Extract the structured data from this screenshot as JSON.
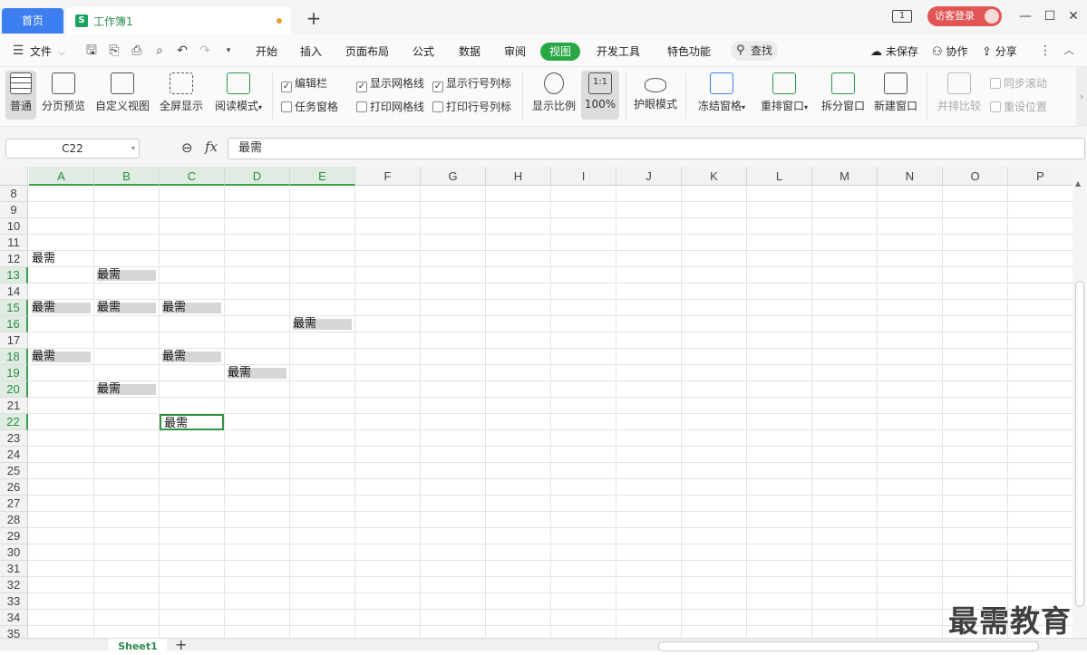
{
  "tabbar": {
    "home_label": "首页",
    "doc_title": "工作簿1",
    "doc_icon": "S",
    "new_tab_symbol": "+",
    "login_label": "访客登录",
    "window_count_icon": "1"
  },
  "menubar": {
    "file_label": "文件",
    "items": [
      "开始",
      "插入",
      "页面布局",
      "公式",
      "数据",
      "审阅",
      "视图",
      "开发工具",
      "特色功能"
    ],
    "active_item": "视图",
    "search_label": "查找",
    "unsaved_label": "未保存",
    "collab_label": "协作",
    "share_label": "分享"
  },
  "ribbon": {
    "normal_label": "普通",
    "page_break_label": "分页预览",
    "custom_view_label": "自定义视图",
    "fullscreen_label": "全屏显示",
    "read_mode_label": "阅读模式",
    "edit_bar_label": "编辑栏",
    "task_pane_label": "任务窗格",
    "show_gridlines_label": "显示网格线",
    "print_gridlines_label": "打印网格线",
    "show_headers_label": "显示行号列标",
    "print_headers_label": "打印行号列标",
    "zoom_label": "显示比例",
    "zoom_100_label": "100%",
    "zoom_100_icon": "1:1",
    "eye_mode_label": "护眼模式",
    "freeze_label": "冻结窗格",
    "rearrange_label": "重排窗口",
    "split_label": "拆分窗口",
    "new_window_label": "新建窗口",
    "side_by_side_label": "并排比较",
    "sync_scroll_label": "同步滚动",
    "reset_position_label": "重设位置",
    "checkbox_states": {
      "edit_bar": true,
      "task_pane": false,
      "show_gridlines": true,
      "print_gridlines": false,
      "show_headers": true,
      "print_headers": false
    }
  },
  "formula_bar": {
    "name_box": "C22",
    "fx_label": "fx",
    "value": "最需"
  },
  "grid": {
    "columns": [
      "A",
      "B",
      "C",
      "D",
      "E",
      "F",
      "G",
      "H",
      "I",
      "J",
      "K",
      "L",
      "M",
      "N",
      "O",
      "P"
    ],
    "selected_columns": [
      "A",
      "B",
      "C",
      "D",
      "E"
    ],
    "rows": [
      8,
      9,
      10,
      11,
      12,
      13,
      14,
      15,
      16,
      17,
      18,
      19,
      20,
      21,
      22,
      23,
      24,
      25,
      26,
      27,
      28,
      29,
      30,
      31,
      32,
      33,
      34,
      35
    ],
    "selected_rows": [
      13,
      15,
      16,
      18,
      19,
      20,
      22
    ],
    "cells": [
      {
        "row": 12,
        "col": "A",
        "text": "最需",
        "highlight": false
      },
      {
        "row": 13,
        "col": "B",
        "text": "最需",
        "highlight": true
      },
      {
        "row": 15,
        "col": "A",
        "text": "最需",
        "highlight": true
      },
      {
        "row": 15,
        "col": "B",
        "text": "最需",
        "highlight": true
      },
      {
        "row": 15,
        "col": "C",
        "text": "最需",
        "highlight": true
      },
      {
        "row": 16,
        "col": "E",
        "text": "最需",
        "highlight": true
      },
      {
        "row": 18,
        "col": "A",
        "text": "最需",
        "highlight": true
      },
      {
        "row": 18,
        "col": "C",
        "text": "最需",
        "highlight": true
      },
      {
        "row": 19,
        "col": "D",
        "text": "最需",
        "highlight": true
      },
      {
        "row": 20,
        "col": "B",
        "text": "最需",
        "highlight": true
      },
      {
        "row": 22,
        "col": "C",
        "text": "最需",
        "highlight": false,
        "active": true
      }
    ]
  },
  "sheets": {
    "tabs": [
      "Sheet1"
    ],
    "add_symbol": "+"
  },
  "watermark": "最需教育",
  "colors": {
    "accent_green": "#28a745",
    "home_tab_blue": "#3d7ef0",
    "login_red": "#e25555"
  }
}
